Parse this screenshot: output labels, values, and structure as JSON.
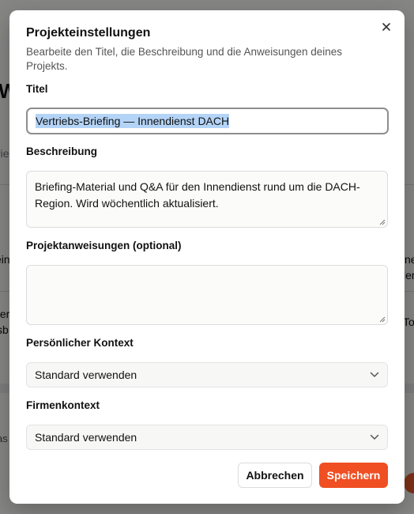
{
  "background": {
    "fragments": [
      "W",
      "rie",
      "ein",
      "ne",
      "len",
      "ter",
      "sb",
      "To",
      "as"
    ]
  },
  "modal": {
    "title": "Projekteinstellungen",
    "subtitle": "Bearbeite den Titel, die Beschreibung und die Anweisungen deines Projekts.",
    "close_icon": "close-icon",
    "fields": {
      "title_label": "Titel",
      "title_value": "Vertriebs-Briefing — Innendienst DACH",
      "description_label": "Beschreibung",
      "description_value": "Briefing-Material und Q&A für den Innendienst rund um die DACH-Region. Wird wöchentlich aktualisiert.",
      "instructions_label": "Projektanweisungen (optional)",
      "instructions_value": "",
      "personal_context_label": "Persönlicher Kontext",
      "personal_context_value": "Standard verwenden",
      "company_context_label": "Firmenkontext",
      "company_context_value": "Standard verwenden"
    },
    "buttons": {
      "cancel": "Abbrechen",
      "save": "Speichern"
    }
  },
  "colors": {
    "accent": "#f04e23",
    "selection": "#b4d4f7",
    "overlay": "#7d7d7d"
  }
}
